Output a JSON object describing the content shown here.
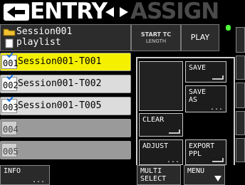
{
  "title": {
    "main": "ENTRY",
    "sub": "ASSIGN"
  },
  "header": {
    "session_name": "Session001",
    "playlist_label": "playlist",
    "start_tc_label": "START TC",
    "length_label": "LENGTH",
    "play_label": "PLAY"
  },
  "rows": [
    {
      "num": "001",
      "name": "Session001-T001",
      "selected": true,
      "checked": true
    },
    {
      "num": "002",
      "name": "Session001-T002",
      "selected": false,
      "checked": true
    },
    {
      "num": "003",
      "name": "Session001-T005",
      "selected": false,
      "checked": true
    },
    {
      "num": "004",
      "name": "",
      "selected": false,
      "checked": false
    },
    {
      "num": "005",
      "name": "",
      "selected": false,
      "checked": false
    }
  ],
  "popup": {
    "save": "SAVE",
    "save_as": "SAVE\nAS",
    "clear": "CLEAR",
    "adjust": "ADJUST",
    "export": "EXPORT\nPPL",
    "dots": "..."
  },
  "bottom": {
    "info": "INFO",
    "info_dots": "...",
    "multi_select": "MULTI\nSELECT",
    "menu": "MENU"
  },
  "colors": {
    "selected_row": "#f5f000",
    "status_dot": "#4cff3a"
  }
}
